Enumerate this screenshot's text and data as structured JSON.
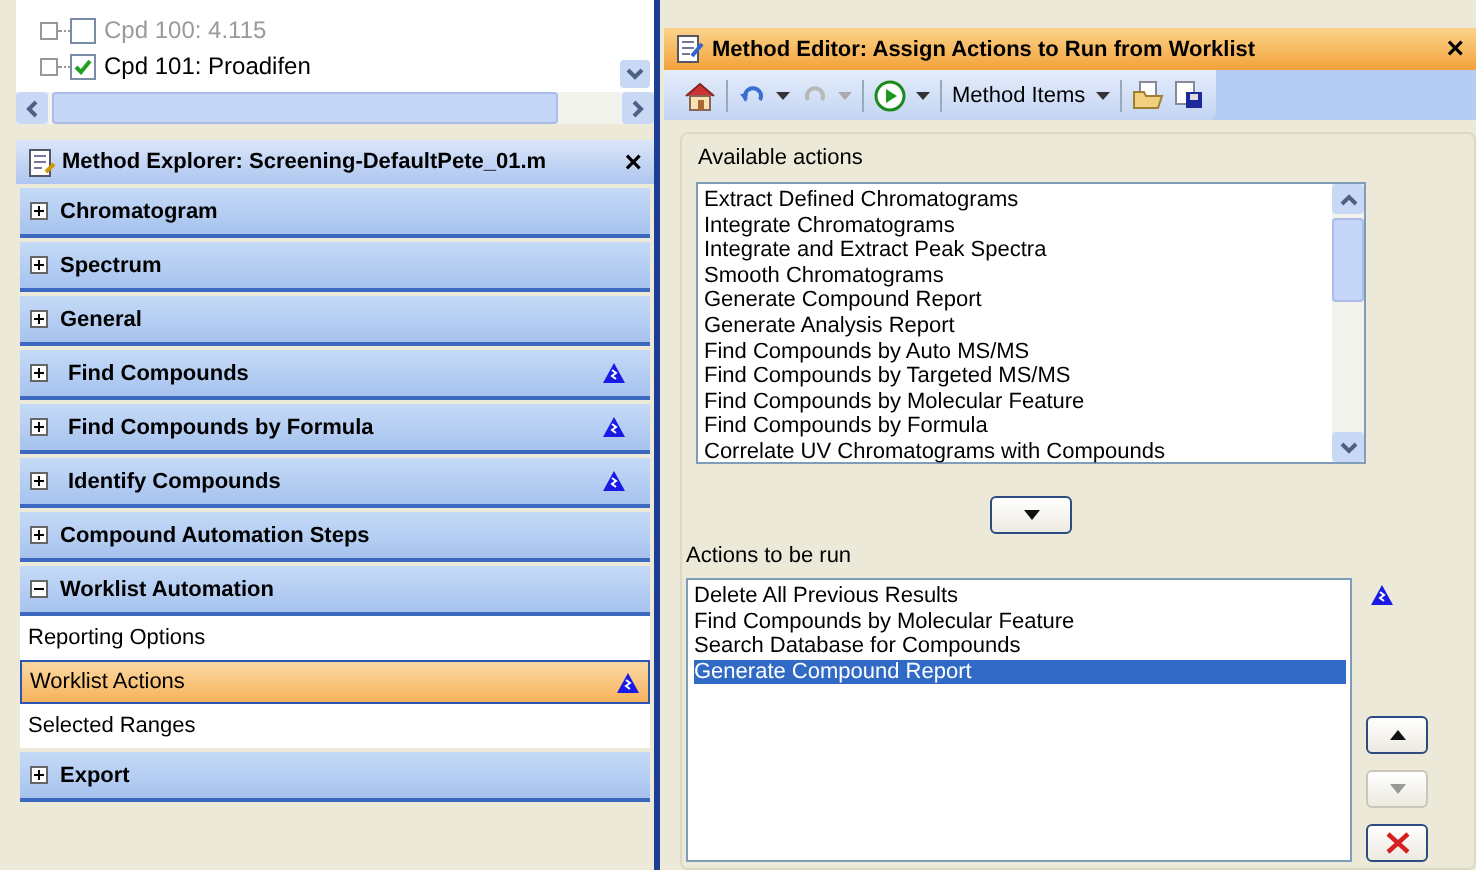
{
  "tree": {
    "items": [
      {
        "label": "Cpd 100: 4.115",
        "checked": false,
        "dimmed": true
      },
      {
        "label": "Cpd 101: Proadifen",
        "checked": true,
        "dimmed": false
      }
    ]
  },
  "explorer": {
    "title": "Method Explorer: Screening-DefaultPete_01.m",
    "close": "×",
    "sections": [
      {
        "label": "Chromatogram",
        "expanded": false
      },
      {
        "label": "Spectrum",
        "expanded": false
      },
      {
        "label": "General",
        "expanded": false
      },
      {
        "label": "Find Compounds",
        "expanded": false,
        "warning": true,
        "indent": true
      },
      {
        "label": "Find Compounds by Formula",
        "expanded": false,
        "warning": true,
        "indent": true
      },
      {
        "label": "Identify Compounds",
        "expanded": false,
        "warning": true,
        "indent": true
      },
      {
        "label": "Compound Automation Steps",
        "expanded": false
      },
      {
        "label": "Worklist Automation",
        "expanded": true,
        "children": [
          {
            "label": "Reporting Options",
            "selected": false
          },
          {
            "label": "Worklist Actions",
            "selected": true,
            "warning": true
          },
          {
            "label": "Selected Ranges",
            "selected": false
          }
        ]
      },
      {
        "label": "Export",
        "expanded": false
      }
    ]
  },
  "editor": {
    "title": "Method Editor: Assign Actions to Run from Worklist",
    "close": "×",
    "method_items": "Method Items",
    "available": {
      "label": "Available actions",
      "items": [
        "Extract Defined Chromatograms",
        "Integrate Chromatograms",
        "Integrate and Extract Peak Spectra",
        "Smooth Chromatograms",
        "Generate Compound Report",
        "Generate Analysis Report",
        "Find Compounds by Auto MS/MS",
        "Find Compounds by Targeted MS/MS",
        "Find Compounds by Molecular Feature",
        "Find Compounds by Formula",
        "Correlate UV Chromatograms with Compounds"
      ]
    },
    "to_run": {
      "label": "Actions to be run",
      "warning": true,
      "items": [
        {
          "label": "Delete All Previous Results",
          "selected": false
        },
        {
          "label": "Find Compounds by Molecular Feature",
          "selected": false
        },
        {
          "label": "Search Database for Compounds",
          "selected": false
        },
        {
          "label": "Generate Compound Report",
          "selected": true
        }
      ]
    },
    "move_up_disabled": false,
    "move_down_disabled": true
  }
}
